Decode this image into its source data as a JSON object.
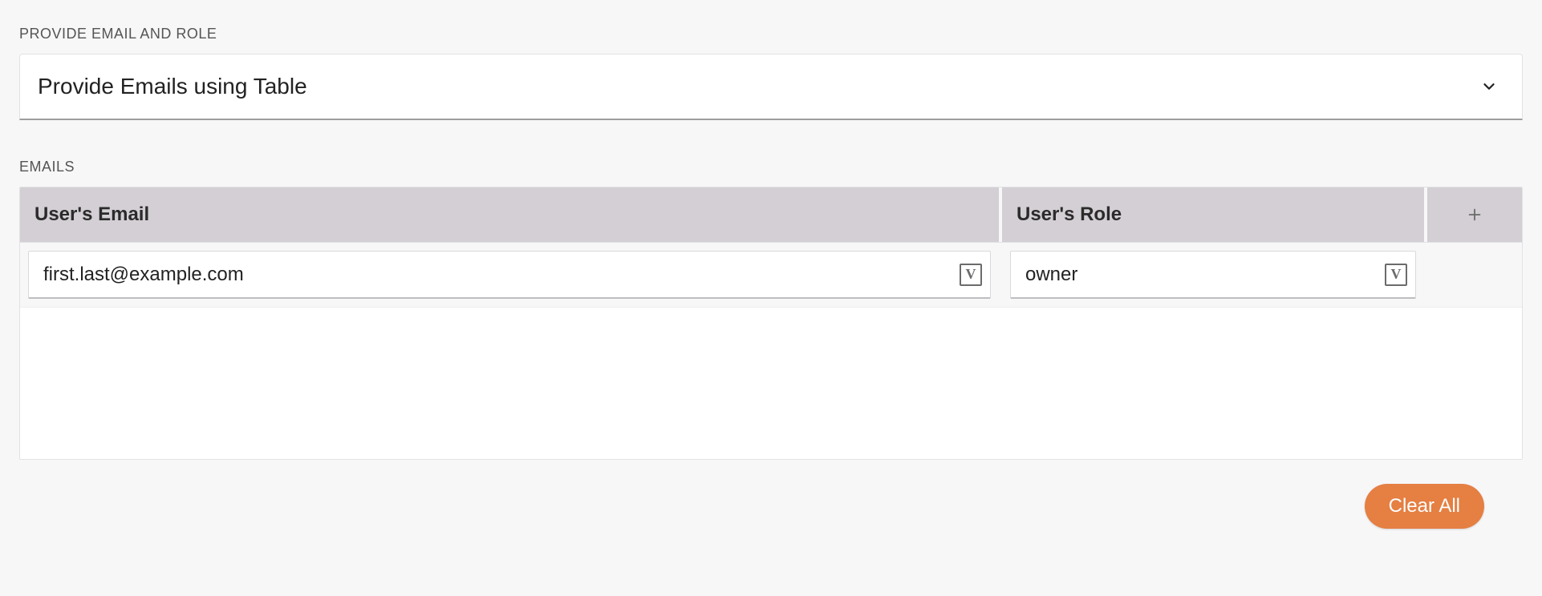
{
  "labels": {
    "section_provide": "PROVIDE EMAIL AND ROLE",
    "section_emails": "EMAILS"
  },
  "dropdown": {
    "selected_label": "Provide Emails using Table"
  },
  "table": {
    "headers": {
      "email": "User's Email",
      "role": "User's Role"
    },
    "rows": [
      {
        "email": "first.last@example.com",
        "role": "owner"
      }
    ]
  },
  "buttons": {
    "clear_all": "Clear All"
  },
  "icons": {
    "variable_glyph": "V"
  }
}
